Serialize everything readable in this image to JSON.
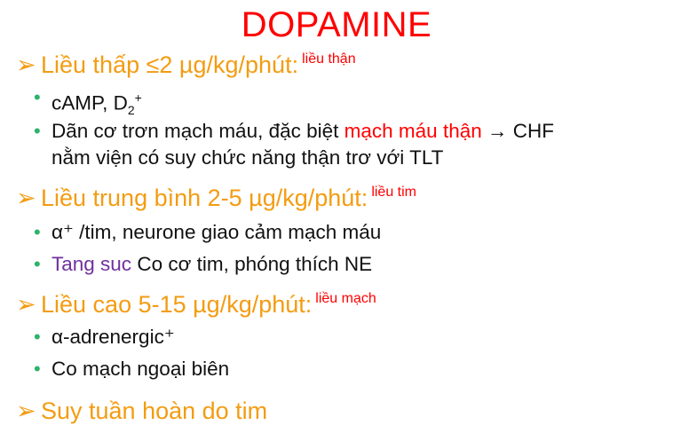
{
  "colors": {
    "title": "#ff0000",
    "heading": "#f39c12",
    "bullet": "#2db36b",
    "accent_red": "#ff0000",
    "accent_purple": "#7030a0",
    "body_text": "#111111"
  },
  "icons": {
    "heading_marker": "arrow-marker-icon",
    "bullet_marker": "bullet-dot-icon"
  },
  "title": "DOPAMINE",
  "sections": [
    {
      "heading": "Liều thấp ≤2 µg/kg/phút:",
      "note": "liều thận",
      "bullets": [
        {
          "text": "cAMP, D",
          "sub": "2",
          "sup": "+"
        },
        {
          "line1_a": "Dãn cơ trơn mạch máu, đặc biệt ",
          "line1_red": "mạch máu thận",
          "line1_b": " → CHF",
          "line2": "nằm viện có suy chức năng thận trơ với TLT"
        }
      ]
    },
    {
      "heading": "Liều trung bình 2-5 µg/kg/phút:",
      "note": "liều tim",
      "bullets": [
        {
          "text": "α⁺ /tim, neurone giao cảm mạch máu"
        },
        {
          "purple": "Tang suc",
          "text": " Co cơ tim, phóng thích NE"
        }
      ]
    },
    {
      "heading": "Liều cao 5-15 µg/kg/phút:",
      "note": "liều mạch",
      "bullets": [
        {
          "text": "α-adrenergic⁺"
        },
        {
          "text": "Co mạch ngoại biên"
        }
      ]
    },
    {
      "heading": "Suy tuần hoàn do tim"
    }
  ]
}
